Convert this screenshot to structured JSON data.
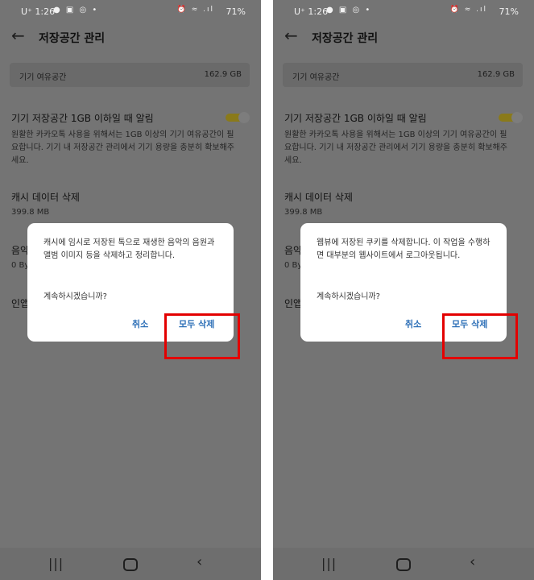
{
  "status_bar": {
    "carrier": "U⁺",
    "time": "1:26",
    "battery": "71%"
  },
  "header": {
    "title": "저장공간 관리"
  },
  "storage": {
    "label": "기기 여유공간",
    "value": "162.9 GB"
  },
  "alert_setting": {
    "title": "기기 저장공간 1GB 이하일 때 알림",
    "description": "원활한 카카오톡 사용을 위해서는 1GB 이상의 기기 여유공간이 필요합니다. 기기 내 저장공간 관리에서 기기 용량을 충분히 확보해주세요.",
    "enabled": true
  },
  "cache_setting": {
    "title": "캐시 데이터 삭제",
    "size": "399.8 MB"
  },
  "music_setting": {
    "title_partial": "음악",
    "size_partial": "0 By"
  },
  "last_setting": {
    "title_partial": "인앱"
  },
  "dialogs": {
    "left": {
      "message": "캐시에 임시로 저장된 톡으로 재생한 음악의 음원과 앨범 이미지 등을 삭제하고 정리합니다.",
      "question": "계속하시겠습니까?",
      "cancel_label": "취소",
      "confirm_label": "모두 삭제"
    },
    "right": {
      "message": "웹뷰에 저장된 쿠키를 삭제합니다. 이 작업을 수행하면 대부분의 웹사이트에서 로그아웃됩니다.",
      "question": "계속하시겠습니까?",
      "cancel_label": "취소",
      "confirm_label": "모두 삭제"
    }
  },
  "highlight_color": "#e30000",
  "accent_color": "#2d6fb7",
  "icons": {
    "back": "arrow-left",
    "nav_recent": "recent-apps",
    "nav_home": "home",
    "nav_back": "back-chevron"
  }
}
